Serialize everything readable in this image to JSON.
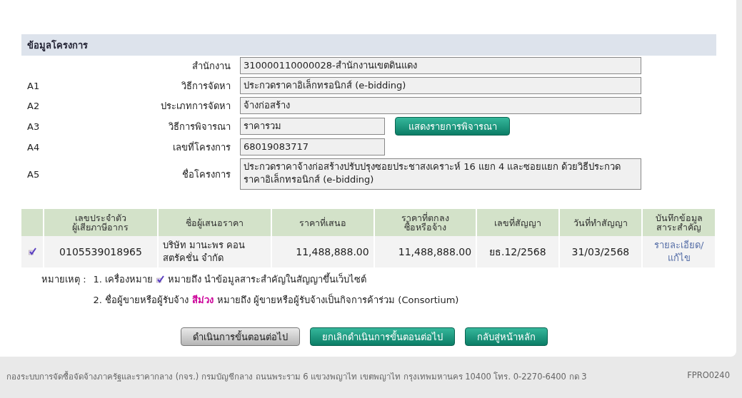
{
  "section": {
    "title": "ข้อมูลโครงการ"
  },
  "fields": [
    {
      "label": "สำนักงาน",
      "value": "310000110000028-สำนักงานเขตดินแดง",
      "kind": "wide"
    },
    {
      "code": "A1",
      "label": "วิธีการจัดหา",
      "value": "ประกวดราคาอิเล็กทรอนิกส์ (e-bidding)",
      "kind": "wide"
    },
    {
      "code": "A2",
      "label": "ประเภทการจัดหา",
      "value": "จ้างก่อสร้าง",
      "kind": "wide"
    },
    {
      "code": "A3",
      "label": "วิธีการพิจารณา",
      "value": "ราคารวม",
      "kind": "short",
      "button": "แสดงรายการพิจารณา"
    },
    {
      "code": "A4",
      "label": "เลขที่โครงการ",
      "value": "68019083717",
      "kind": "short"
    },
    {
      "code": "A5",
      "label": "ชื่อโครงการ",
      "value": "ประกวดราคาจ้างก่อสร้างปรับปรุงซอยประชาสงเคราะห์ 16 แยก 4 และซอยแยก ด้วยวิธีประกวดราคาอิเล็กทรอนิกส์ (e-bidding)",
      "kind": "multiline"
    }
  ],
  "table": {
    "columns": [
      "เลขประจำตัว\nผู้เสียภาษีอากร",
      "ชื่อผู้เสนอราคา",
      "ราคาที่เสนอ",
      "ราคาที่ตกลง\nซื้อหรือจ้าง",
      "เลขที่สัญญา",
      "วันที่ทำสัญญา",
      "บันทึกข้อมูล\nสาระสำคัญ"
    ],
    "rows": [
      {
        "marked": true,
        "tax_id": "0105539018965",
        "bidder": "บริษัท มานะพร คอน\nสตรัคชั่น จำกัด",
        "offered_price": "11,488,888.00",
        "agreed_price": "11,488,888.00",
        "contract_no": "ยธ.12/2568",
        "contract_date": "31/03/2568",
        "link": "รายละเอียด/\nแก้ไข"
      }
    ]
  },
  "notes": {
    "label": "หมายเหตุ :",
    "note_1": {
      "before": "1. เครื่องหมาย",
      "after": "หมายถึง นำข้อมูลสาระสำคัญในสัญญาขึ้นเว็บไซต์"
    },
    "note_2": {
      "before": "2. ชื่อผู้ขายหรือผู้รับจ้าง",
      "highlight": "สีม่วง",
      "color": "#cc0099",
      "after": "หมายถึง ผู้ขายหรือผู้รับจ้างเป็นกิจการค้าร่วม (Consortium)"
    }
  },
  "buttons": [
    {
      "label": "ดำเนินการขั้นตอนต่อไป",
      "kind": "grey"
    },
    {
      "label": "ยกเลิกดำเนินการขั้นตอนต่อไป",
      "kind": "teal"
    },
    {
      "label": "กลับสู่หน้าหลัก",
      "kind": "teal"
    }
  ],
  "footer": {
    "text": "กองระบบการจัดซื้อจัดจ้างภาครัฐและราคากลาง (กจร.) กรมบัญชีกลาง ถนนพระราม 6 แขวงพญาไท เขตพญาไท กรุงเทพมหานคร 10400 โทร. 0-2270-6400 กด 3",
    "code": "FPRO0240"
  }
}
